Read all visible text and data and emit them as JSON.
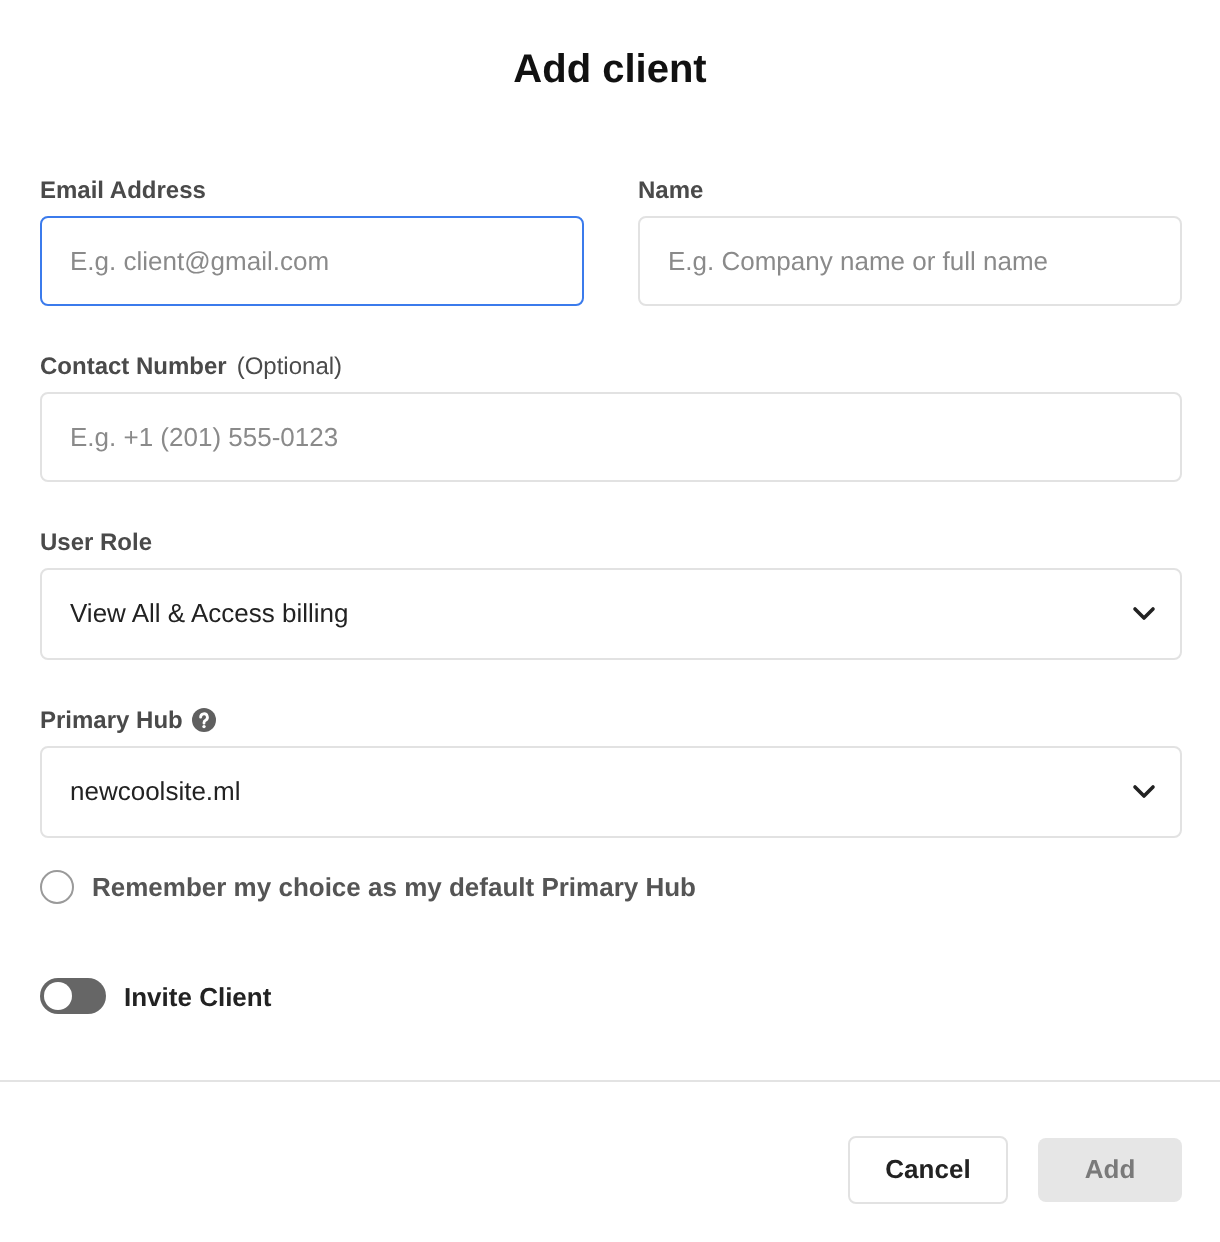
{
  "dialog": {
    "title": "Add client"
  },
  "rows": [
    [
      {
        "kind": "text",
        "label": "Email Address",
        "placeholder": "E.g. client@gmail.com",
        "focused": true
      },
      {
        "kind": "text",
        "label": "Name",
        "placeholder": "E.g. Company name or full name",
        "focused": false
      }
    ],
    [
      {
        "kind": "text",
        "label": "Contact Number",
        "hint": "(Optional)",
        "placeholder": "E.g. +1 (201) 555-0123",
        "focused": false
      }
    ],
    [
      {
        "kind": "select",
        "label": "User Role",
        "value": "View All & Access billing",
        "focused": false
      }
    ],
    [
      {
        "kind": "select",
        "label": "Primary Hub",
        "help": true,
        "value": "newcoolsite.ml",
        "focused": false
      }
    ]
  ],
  "remember_default": {
    "label": "Remember my choice as my default Primary Hub",
    "checked": false
  },
  "invite_toggle": {
    "label": "Invite Client",
    "on": false
  },
  "buttons": [
    {
      "label": "Cancel",
      "kind": "secondary",
      "disabled": false
    },
    {
      "label": "Add",
      "kind": "primary",
      "disabled": true
    }
  ]
}
